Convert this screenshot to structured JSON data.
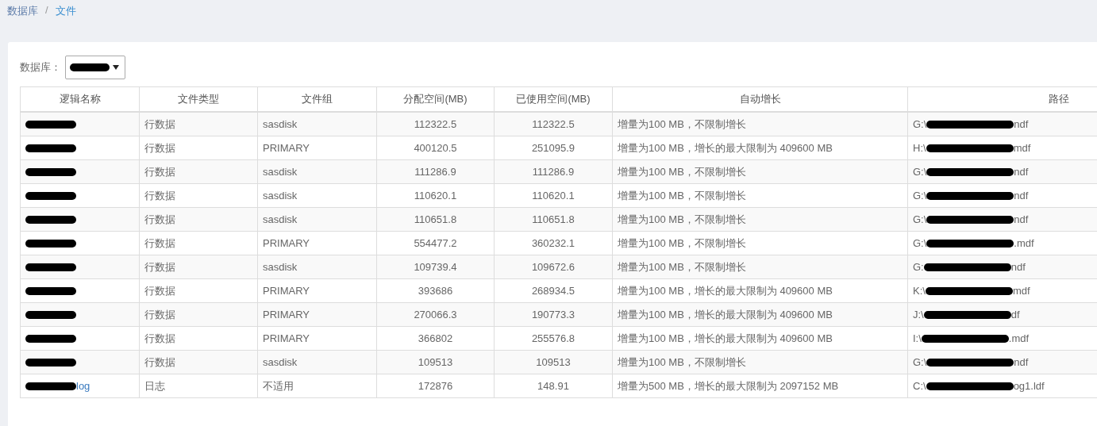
{
  "breadcrumb": {
    "separator": "/",
    "items": [
      {
        "label": "数据库"
      },
      {
        "label": "文件"
      }
    ]
  },
  "filter": {
    "label": "数据库：",
    "select": {
      "redacted": true
    }
  },
  "table": {
    "columns": [
      "逻辑名称",
      "文件类型",
      "文件组",
      "分配空间(MB)",
      "已使用空间(MB)",
      "自动增长",
      "路径"
    ],
    "rows": [
      {
        "name": {
          "redacted": true
        },
        "type": "行数据",
        "group": "sasdisk",
        "allocated": "112322.5",
        "used": "112322.5",
        "growth": "增量为100 MB，不限制增长",
        "path": {
          "prefix": "G:\\",
          "redacted": true,
          "suffix": "ndf"
        }
      },
      {
        "name": {
          "redacted": true
        },
        "type": "行数据",
        "group": "PRIMARY",
        "allocated": "400120.5",
        "used": "251095.9",
        "growth": "增量为100 MB，增长的最大限制为 409600 MB",
        "path": {
          "prefix": "H:\\",
          "redacted": true,
          "suffix": "mdf"
        }
      },
      {
        "name": {
          "redacted": true
        },
        "type": "行数据",
        "group": "sasdisk",
        "allocated": "111286.9",
        "used": "111286.9",
        "growth": "增量为100 MB，不限制增长",
        "path": {
          "prefix": "G:\\",
          "redacted": true,
          "suffix": "ndf"
        }
      },
      {
        "name": {
          "redacted": true
        },
        "type": "行数据",
        "group": "sasdisk",
        "allocated": "110620.1",
        "used": "110620.1",
        "growth": "增量为100 MB，不限制增长",
        "path": {
          "prefix": "G:\\",
          "redacted": true,
          "suffix": "ndf"
        }
      },
      {
        "name": {
          "redacted": true
        },
        "type": "行数据",
        "group": "sasdisk",
        "allocated": "110651.8",
        "used": "110651.8",
        "growth": "增量为100 MB，不限制增长",
        "path": {
          "prefix": "G:\\",
          "redacted": true,
          "suffix": "ndf"
        }
      },
      {
        "name": {
          "redacted": true
        },
        "type": "行数据",
        "group": "PRIMARY",
        "allocated": "554477.2",
        "used": "360232.1",
        "growth": "增量为100 MB，不限制增长",
        "path": {
          "prefix": "G:\\",
          "redacted": true,
          "suffix": ".mdf"
        }
      },
      {
        "name": {
          "redacted": true
        },
        "type": "行数据",
        "group": "sasdisk",
        "allocated": "109739.4",
        "used": "109672.6",
        "growth": "增量为100 MB，不限制增长",
        "path": {
          "prefix": "G:",
          "redacted": true,
          "suffix": "ndf"
        }
      },
      {
        "name": {
          "redacted": true
        },
        "type": "行数据",
        "group": "PRIMARY",
        "allocated": "393686",
        "used": "268934.5",
        "growth": "增量为100 MB，增长的最大限制为 409600 MB",
        "path": {
          "prefix": "K:\\",
          "redacted": true,
          "suffix": "mdf"
        }
      },
      {
        "name": {
          "redacted": true
        },
        "type": "行数据",
        "group": "PRIMARY",
        "allocated": "270066.3",
        "used": "190773.3",
        "growth": "增量为100 MB，增长的最大限制为 409600 MB",
        "path": {
          "prefix": "J:\\",
          "redacted": true,
          "suffix": "df"
        }
      },
      {
        "name": {
          "redacted": true
        },
        "type": "行数据",
        "group": "PRIMARY",
        "allocated": "366802",
        "used": "255576.8",
        "growth": "增量为100 MB，增长的最大限制为 409600 MB",
        "path": {
          "prefix": "I:\\",
          "redacted": true,
          "suffix": ".mdf"
        }
      },
      {
        "name": {
          "redacted": true
        },
        "type": "行数据",
        "group": "sasdisk",
        "allocated": "109513",
        "used": "109513",
        "growth": "增量为100 MB，不限制增长",
        "path": {
          "prefix": "G:\\",
          "redacted": true,
          "suffix": "ndf"
        }
      },
      {
        "name": {
          "redacted": true,
          "suffix": "log"
        },
        "type": "日志",
        "group": "不适用",
        "allocated": "172876",
        "used": "148.91",
        "growth": "增量为500 MB，增长的最大限制为 2097152 MB",
        "path": {
          "prefix": "C:\\",
          "redacted": true,
          "suffix": "og1.ldf"
        }
      }
    ]
  }
}
